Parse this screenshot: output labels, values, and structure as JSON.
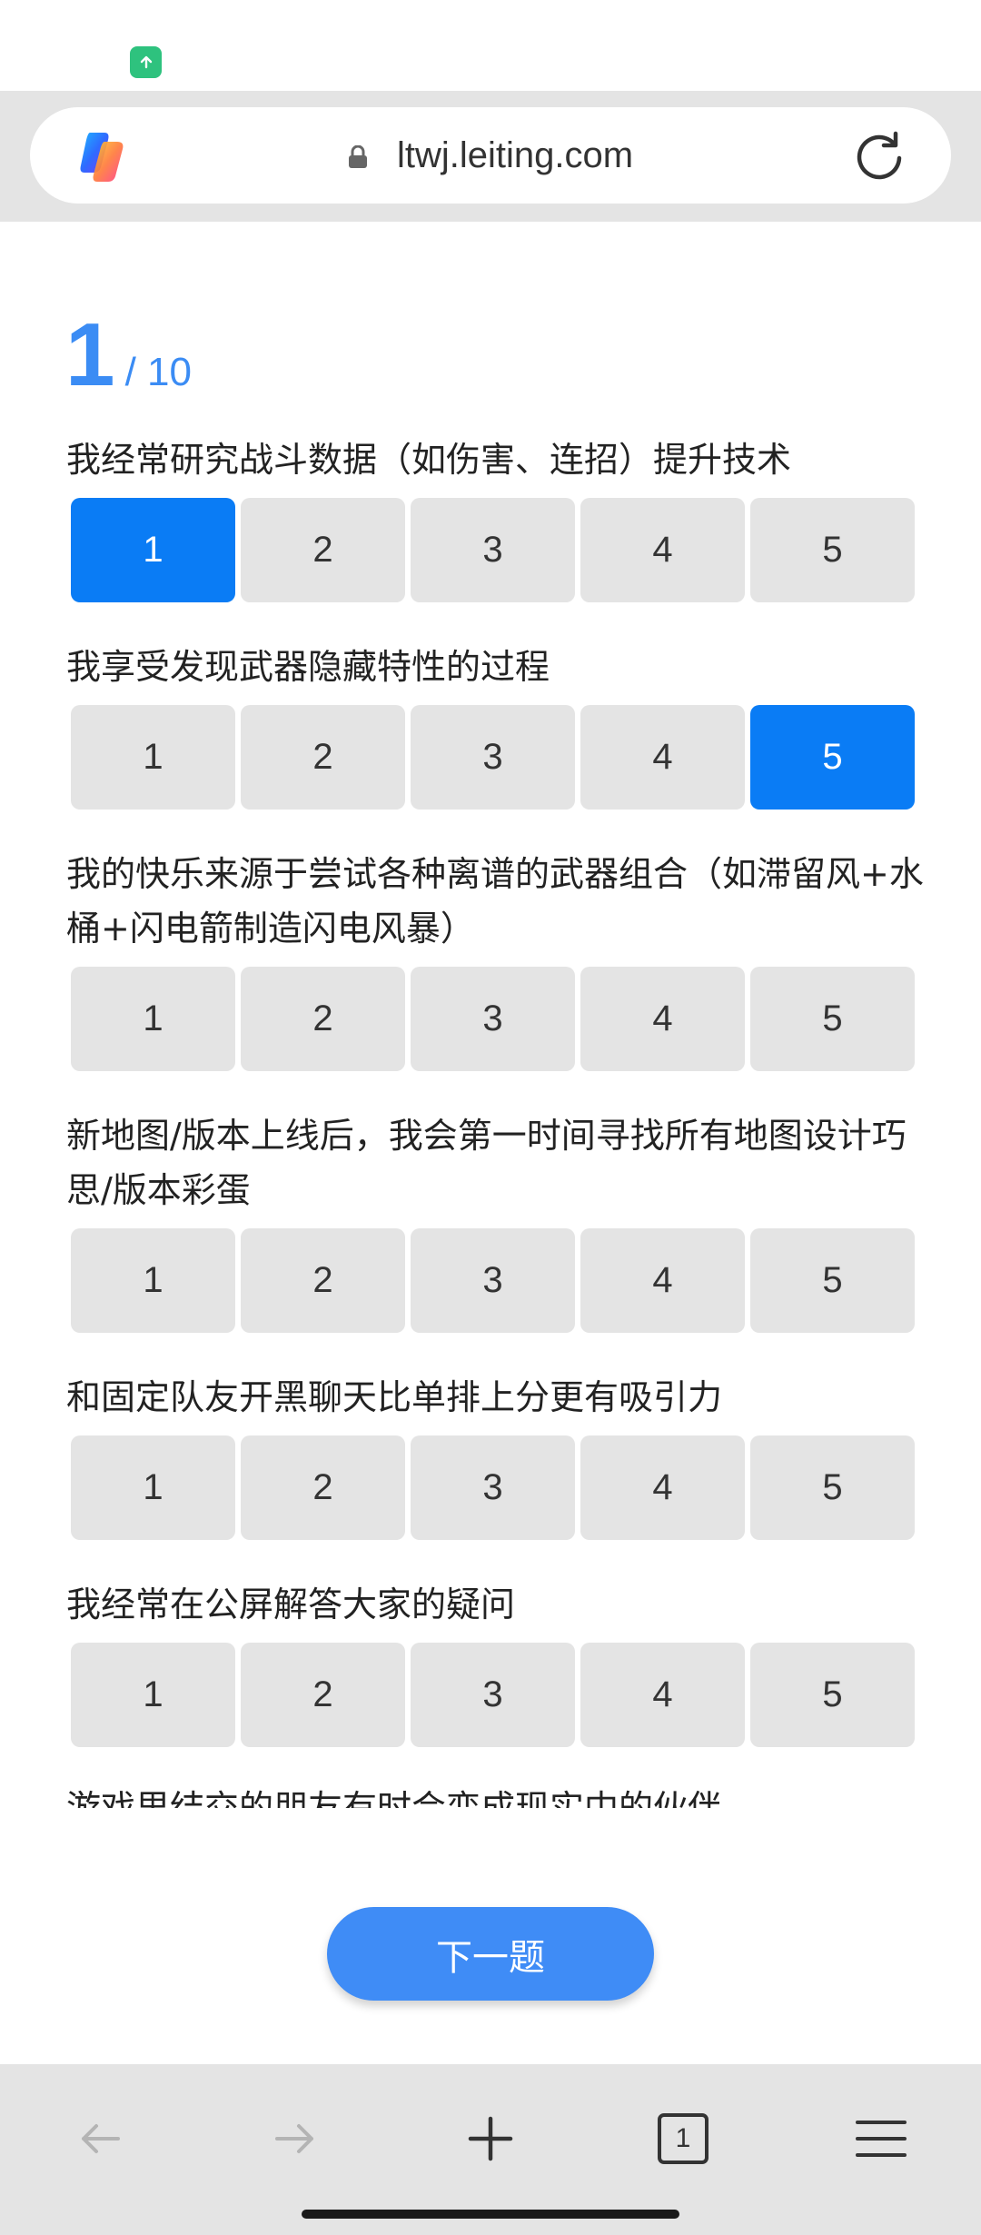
{
  "browser": {
    "url": "ltwj.leiting.com"
  },
  "progress": {
    "current": "1",
    "total": "/ 10"
  },
  "questions": [
    {
      "text": "我经常研究战斗数据（如伤害、连招）提升技术",
      "options": [
        "1",
        "2",
        "3",
        "4",
        "5"
      ],
      "selected": "1"
    },
    {
      "text": "我享受发现武器隐藏特性的过程",
      "options": [
        "1",
        "2",
        "3",
        "4",
        "5"
      ],
      "selected": "5"
    },
    {
      "text": "我的快乐来源于尝试各种离谱的武器组合（如滞留风+水桶+闪电箭制造闪电风暴）",
      "options": [
        "1",
        "2",
        "3",
        "4",
        "5"
      ],
      "selected": null
    },
    {
      "text": "新地图/版本上线后，我会第一时间寻找所有地图设计巧思/版本彩蛋",
      "options": [
        "1",
        "2",
        "3",
        "4",
        "5"
      ],
      "selected": null
    },
    {
      "text": "和固定队友开黑聊天比单排上分更有吸引力",
      "options": [
        "1",
        "2",
        "3",
        "4",
        "5"
      ],
      "selected": null
    },
    {
      "text": "我经常在公屏解答大家的疑问",
      "options": [
        "1",
        "2",
        "3",
        "4",
        "5"
      ],
      "selected": null
    }
  ],
  "partial_question": "游戏里结交的朋友有时会变成现实中的伙伴",
  "next_button": "下一题",
  "tabs_count": "1",
  "colors": {
    "accent": "#0a7cf5",
    "button": "#3f8cf6",
    "option_bg": "#e4e4e4",
    "bar_bg": "#e4e4e4"
  }
}
